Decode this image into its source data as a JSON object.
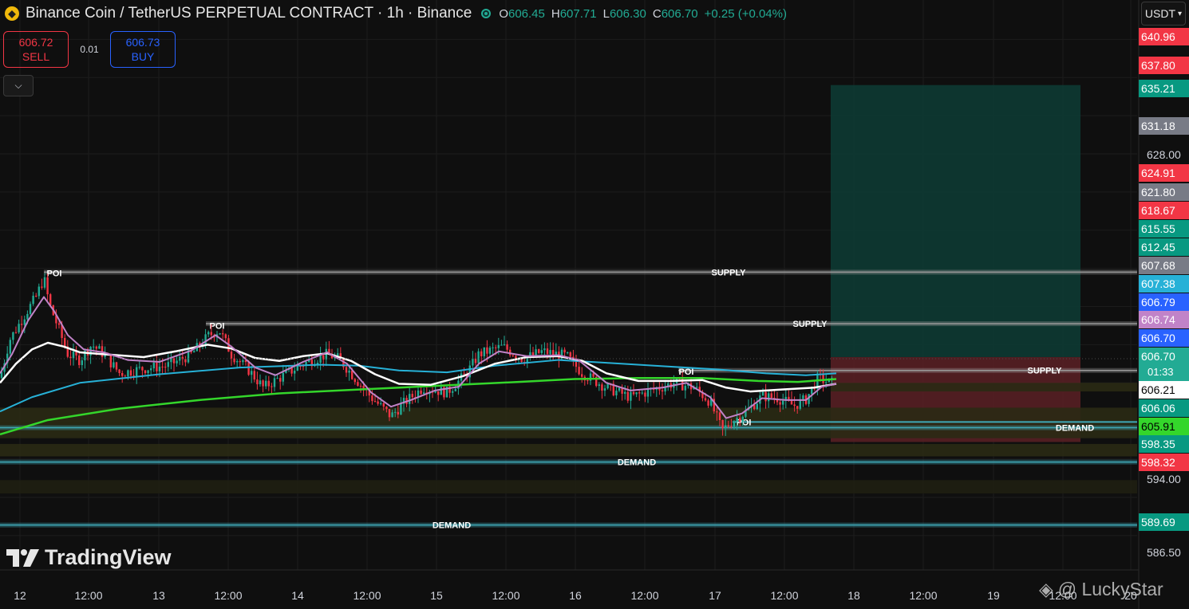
{
  "header": {
    "symbol_icon": "binance-coin-icon",
    "title": "Binance Coin / TetherUS PERPETUAL CONTRACT · 1h · Binance",
    "open_label": "O",
    "open": "606.45",
    "high_label": "H",
    "high": "607.71",
    "low_label": "L",
    "low": "606.30",
    "close_label": "C",
    "close": "606.70",
    "change": "+0.25 (+0.04%)"
  },
  "trade": {
    "sell_price": "606.72",
    "sell_label": "SELL",
    "spread": "0.01",
    "buy_price": "606.73",
    "buy_label": "BUY"
  },
  "currency_selector": "USDT",
  "branding": {
    "logo": "TradingView",
    "watermark": "@ LuckyStar"
  },
  "colors": {
    "background": "#0f0f0f",
    "up": "#22ab94",
    "down": "#f23645",
    "ema_fast": "#c183c8",
    "ema_white": "#ffffff",
    "ema_blue": "#27b1d7",
    "ema_green": "#34d62b",
    "position_profit": "#0d3a33",
    "position_loss": "#5a2025"
  },
  "chart_data": {
    "type": "candlestick",
    "symbol": "BNBUSDT.P",
    "interval": "1h",
    "ylim": [
      585.0,
      642.0
    ],
    "x_ticks": [
      "12",
      "12:00",
      "13",
      "12:00",
      "14",
      "12:00",
      "15",
      "12:00",
      "16",
      "12:00",
      "17",
      "12:00",
      "18",
      "12:00",
      "19",
      "12:00",
      "20"
    ],
    "y_ticks": [
      640.0,
      628.0,
      594.0,
      586.5
    ],
    "price_labels": [
      {
        "value": "640.96",
        "color": "#f23645"
      },
      {
        "value": "637.80",
        "color": "#f23645"
      },
      {
        "value": "635.21",
        "color": "#089981"
      },
      {
        "value": "631.18",
        "color": "#787b86"
      },
      {
        "value": "628.00",
        "color": ""
      },
      {
        "value": "624.91",
        "color": "#f23645"
      },
      {
        "value": "621.80",
        "color": "#787b86"
      },
      {
        "value": "618.67",
        "color": "#f23645"
      },
      {
        "value": "615.55",
        "color": "#089981"
      },
      {
        "value": "612.45",
        "color": "#089981"
      },
      {
        "value": "607.68",
        "color": "#787b86"
      },
      {
        "value": "607.38",
        "color": "#27b1d7"
      },
      {
        "value": "606.79",
        "color": "#2962ff"
      },
      {
        "value": "606.74",
        "color": "#c183c8"
      },
      {
        "value": "606.70",
        "color": "#2962ff"
      },
      {
        "value": "606.70",
        "color": "#22ab94",
        "sub": "01:33"
      },
      {
        "value": "606.21",
        "color": "#ffffff"
      },
      {
        "value": "606.06",
        "color": "#089981"
      },
      {
        "value": "605.91",
        "color": "#34d62b"
      },
      {
        "value": "598.35",
        "color": "#089981"
      },
      {
        "value": "598.32",
        "color": "#f23645"
      },
      {
        "value": "594.00",
        "color": ""
      },
      {
        "value": "589.69",
        "color": "#089981"
      },
      {
        "value": "586.50",
        "color": ""
      }
    ],
    "zones": [
      {
        "label": "SUPPLY",
        "value": 615.6
      },
      {
        "label": "SUPPLY",
        "value": 610.2
      },
      {
        "label": "SUPPLY",
        "value": 605.3
      },
      {
        "label": "DEMAND",
        "value": 599.3
      },
      {
        "label": "DEMAND",
        "value": 595.7
      },
      {
        "label": "DEMAND",
        "value": 589.1
      }
    ],
    "poi_labels": [
      "POI",
      "POI",
      "POI",
      "POI"
    ],
    "position": {
      "entry": 606.7,
      "target": 635.21,
      "stop": 597.8
    },
    "current_price": 606.7
  }
}
